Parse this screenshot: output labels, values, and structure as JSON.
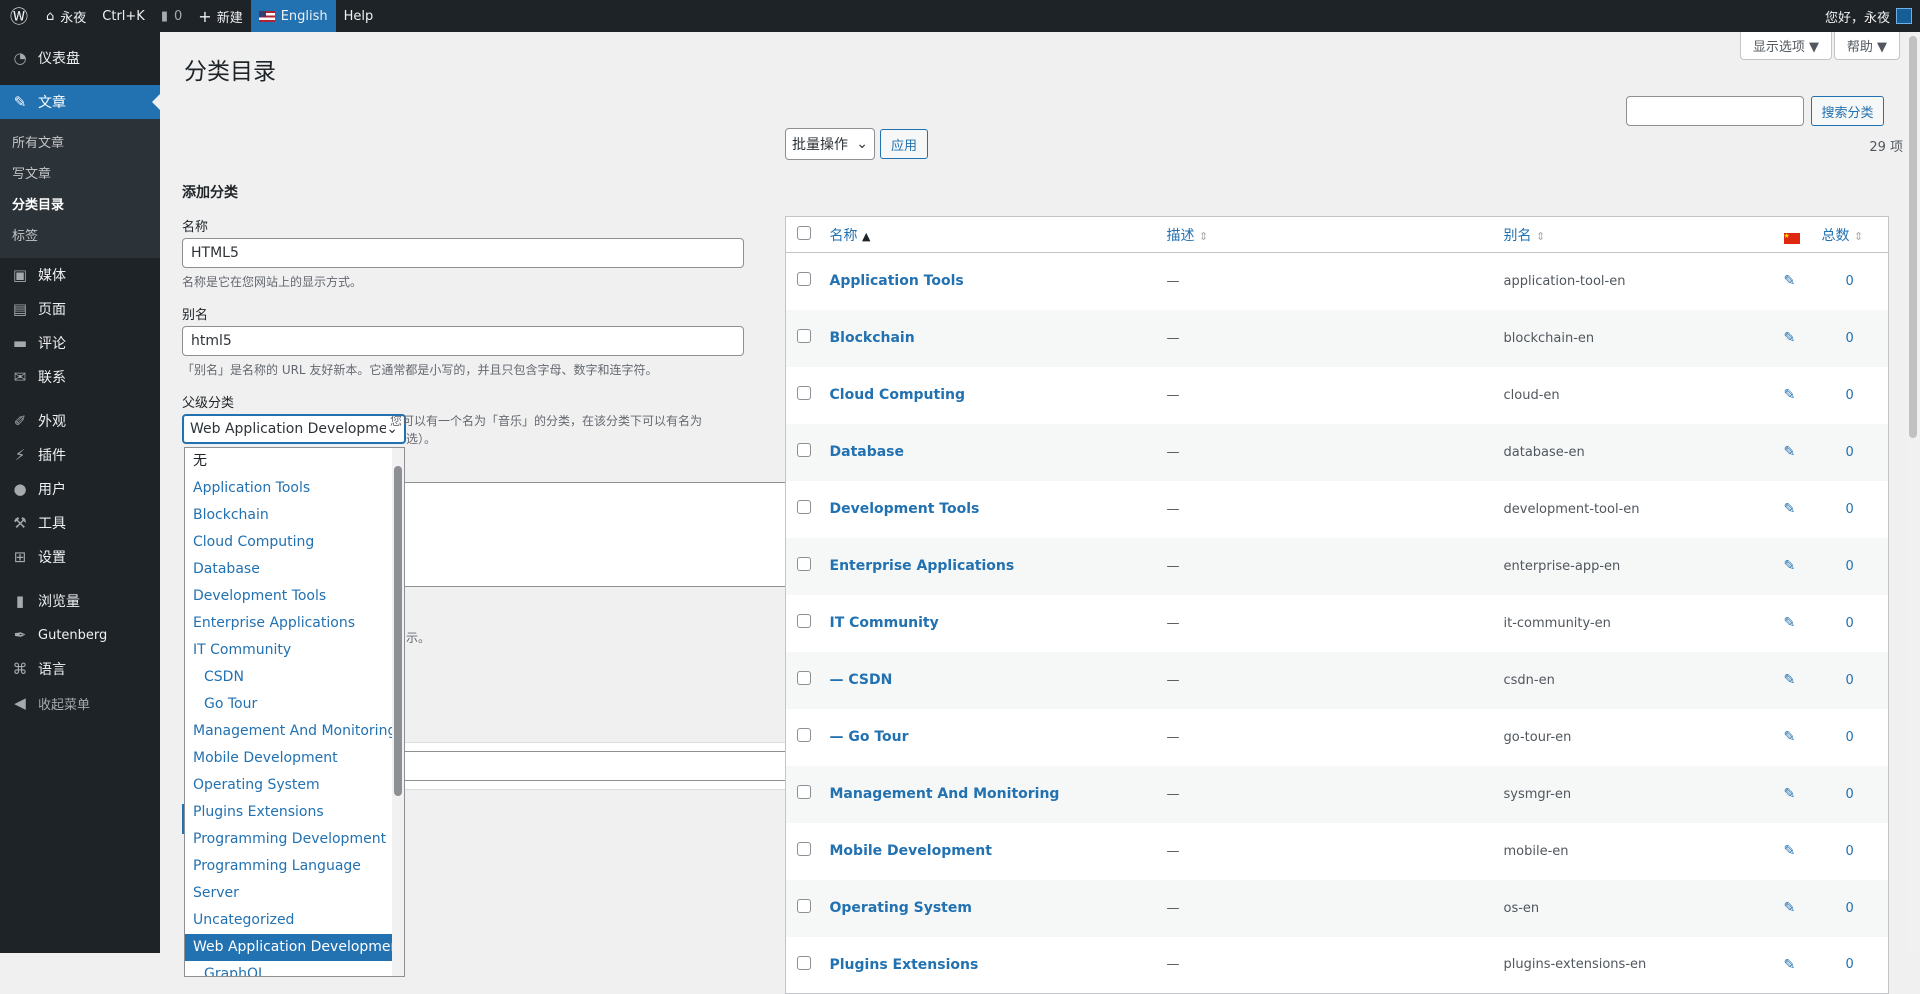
{
  "adminbar": {
    "site_name": "永夜",
    "shortcut": "Ctrl+K",
    "comments_count": "0",
    "new_label": "新建",
    "language": "English",
    "help": "Help",
    "greeting": "您好，永夜"
  },
  "sidebar": {
    "items": [
      {
        "label": "仪表盘",
        "icon": "dashboard-icon"
      },
      {
        "label": "文章",
        "icon": "pin-icon"
      },
      {
        "label": "媒体",
        "icon": "media-icon"
      },
      {
        "label": "页面",
        "icon": "page-icon"
      },
      {
        "label": "评论",
        "icon": "comment-icon"
      },
      {
        "label": "联系",
        "icon": "mail-icon"
      },
      {
        "label": "外观",
        "icon": "brush-icon"
      },
      {
        "label": "插件",
        "icon": "plugin-icon"
      },
      {
        "label": "用户",
        "icon": "user-icon"
      },
      {
        "label": "工具",
        "icon": "wrench-icon"
      },
      {
        "label": "设置",
        "icon": "settings-icon"
      },
      {
        "label": "浏览量",
        "icon": "chart-icon"
      },
      {
        "label": "Gutenberg",
        "icon": "gutenberg-icon"
      },
      {
        "label": "语言",
        "icon": "translate-icon"
      },
      {
        "label": "收起菜单",
        "icon": "collapse-icon"
      }
    ],
    "submenu": [
      "所有文章",
      "写文章",
      "分类目录",
      "标签"
    ]
  },
  "page": {
    "title": "分类目录",
    "screen_options": "显示选项 ▼",
    "help": "帮助 ▼",
    "search_button": "搜索分类",
    "search_value": ""
  },
  "form": {
    "heading": "添加分类",
    "name_label": "名称",
    "name_value": "HTML5",
    "name_desc": "名称是它在您网站上的显示方式。",
    "slug_label": "别名",
    "slug_value": "html5",
    "slug_desc": "「别名」是名称的 URL 友好新本。它通常都是小写的，并且只包含字母、数字和连字符。",
    "parent_label": "父级分类",
    "parent_value": "Web Application Development",
    "parent_desc_partial": "您可以有一个名为「音乐」的分类，在该分类下可以有名为",
    "parent_desc_partial2": "选）。",
    "desc_desc_partial": "示。"
  },
  "dropdown_options": [
    {
      "label": "无",
      "indent": false,
      "selected": false
    },
    {
      "label": "Application Tools",
      "indent": false,
      "selected": false
    },
    {
      "label": "Blockchain",
      "indent": false,
      "selected": false
    },
    {
      "label": "Cloud Computing",
      "indent": false,
      "selected": false
    },
    {
      "label": "Database",
      "indent": false,
      "selected": false
    },
    {
      "label": "Development Tools",
      "indent": false,
      "selected": false
    },
    {
      "label": "Enterprise Applications",
      "indent": false,
      "selected": false
    },
    {
      "label": "IT Community",
      "indent": false,
      "selected": false
    },
    {
      "label": "CSDN",
      "indent": true,
      "selected": false
    },
    {
      "label": "Go Tour",
      "indent": true,
      "selected": false
    },
    {
      "label": "Management And Monitoring",
      "indent": false,
      "selected": false
    },
    {
      "label": "Mobile Development",
      "indent": false,
      "selected": false
    },
    {
      "label": "Operating System",
      "indent": false,
      "selected": false
    },
    {
      "label": "Plugins Extensions",
      "indent": false,
      "selected": false
    },
    {
      "label": "Programming Development",
      "indent": false,
      "selected": false
    },
    {
      "label": "Programming Language",
      "indent": false,
      "selected": false
    },
    {
      "label": "Server",
      "indent": false,
      "selected": false
    },
    {
      "label": "Uncategorized",
      "indent": false,
      "selected": false
    },
    {
      "label": "Web Application Development",
      "indent": false,
      "selected": true
    },
    {
      "label": "GraphQL",
      "indent": true,
      "selected": false
    }
  ],
  "list": {
    "bulk_action": "批量操作",
    "apply": "应用",
    "count": "29 项",
    "columns": {
      "name": "名称",
      "description": "描述",
      "slug": "别名",
      "count": "总数"
    },
    "rows": [
      {
        "name": "Application Tools",
        "desc": "—",
        "slug": "application-tool-en",
        "count": "0"
      },
      {
        "name": "Blockchain",
        "desc": "—",
        "slug": "blockchain-en",
        "count": "0"
      },
      {
        "name": "Cloud Computing",
        "desc": "—",
        "slug": "cloud-en",
        "count": "0"
      },
      {
        "name": "Database",
        "desc": "—",
        "slug": "database-en",
        "count": "0"
      },
      {
        "name": "Development Tools",
        "desc": "—",
        "slug": "development-tool-en",
        "count": "0"
      },
      {
        "name": "Enterprise Applications",
        "desc": "—",
        "slug": "enterprise-app-en",
        "count": "0"
      },
      {
        "name": "IT Community",
        "desc": "—",
        "slug": "it-community-en",
        "count": "0"
      },
      {
        "name": "— CSDN",
        "desc": "—",
        "slug": "csdn-en",
        "count": "0"
      },
      {
        "name": "— Go Tour",
        "desc": "—",
        "slug": "go-tour-en",
        "count": "0"
      },
      {
        "name": "Management And Monitoring",
        "desc": "—",
        "slug": "sysmgr-en",
        "count": "0"
      },
      {
        "name": "Mobile Development",
        "desc": "—",
        "slug": "mobile-en",
        "count": "0"
      },
      {
        "name": "Operating System",
        "desc": "—",
        "slug": "os-en",
        "count": "0"
      },
      {
        "name": "Plugins Extensions",
        "desc": "—",
        "slug": "plugins-extensions-en",
        "count": "0"
      }
    ]
  }
}
